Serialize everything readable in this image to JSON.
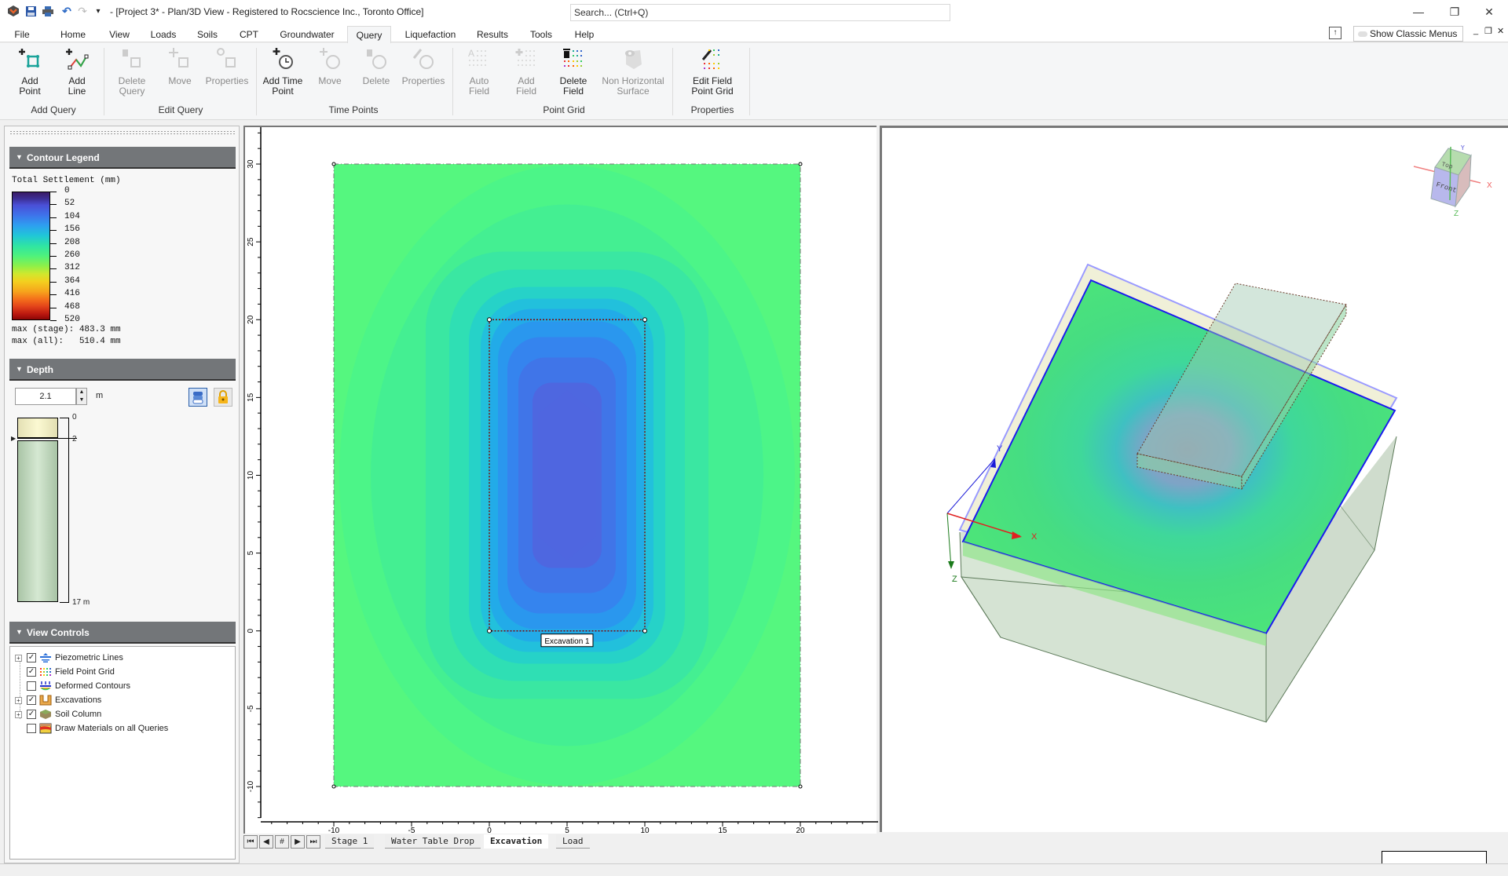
{
  "titlebar": {
    "title": "- [Project 3* - Plan/3D View - Registered to Rocscience Inc., Toronto Office]",
    "search_placeholder": "Search... (Ctrl+Q)",
    "minimize": "—",
    "restore": "❐",
    "close": "✕"
  },
  "menu_tabs": [
    {
      "label": "File"
    },
    {
      "label": "Home"
    },
    {
      "label": "View"
    },
    {
      "label": "Loads"
    },
    {
      "label": "Soils"
    },
    {
      "label": "CPT"
    },
    {
      "label": "Groundwater"
    },
    {
      "label": "Query"
    },
    {
      "label": "Liquefaction"
    },
    {
      "label": "Results"
    },
    {
      "label": "Tools"
    },
    {
      "label": "Help"
    }
  ],
  "active_tab": "Query",
  "show_classic_menus": "Show Classic Menus",
  "ribbon": {
    "add_query": {
      "group": "Add Query",
      "add_point": "Add\nPoint",
      "add_line": "Add\nLine"
    },
    "edit_query": {
      "group": "Edit Query",
      "delete_query": "Delete\nQuery",
      "move": "Move",
      "properties": "Properties"
    },
    "time_points": {
      "group": "Time Points",
      "add_time_point": "Add Time\nPoint",
      "move": "Move",
      "delete": "Delete",
      "properties": "Properties"
    },
    "point_grid": {
      "group": "Point Grid",
      "auto_field": "Auto\nField",
      "add_field": "Add\nField",
      "delete_field": "Delete\nField",
      "non_horizontal_surface": "Non Horizontal\nSurface"
    },
    "properties": {
      "group": "Properties",
      "edit_field_point_grid": "Edit Field\nPoint Grid"
    }
  },
  "contour_legend": {
    "header": "Contour Legend",
    "title": "Total Settlement (mm)",
    "ticks": [
      "0",
      "52",
      "104",
      "156",
      "208",
      "260",
      "312",
      "364",
      "416",
      "468",
      "520"
    ],
    "max_stage": "max (stage): 483.3 mm",
    "max_all": "max (all):   510.4 mm"
  },
  "depth": {
    "header": "Depth",
    "value": "2.1",
    "unit": "m",
    "column_labels": [
      "0",
      "2",
      "17 m"
    ],
    "layer_top": 0,
    "layer_boundary": 2,
    "column_bottom": 17
  },
  "view_controls": {
    "header": "View Controls",
    "items": [
      {
        "label": "Piezometric Lines",
        "checked": true,
        "expandable": true
      },
      {
        "label": "Field Point Grid",
        "checked": true,
        "expandable": false
      },
      {
        "label": "Deformed Contours",
        "checked": false,
        "expandable": false
      },
      {
        "label": "Excavations",
        "checked": true,
        "expandable": true
      },
      {
        "label": "Soil Column",
        "checked": true,
        "expandable": true
      },
      {
        "label": "Draw Materials on all Queries",
        "checked": false,
        "expandable": false
      }
    ]
  },
  "plan_view": {
    "x_ticks": [
      "-10",
      "-5",
      "0",
      "5",
      "10",
      "15",
      "20"
    ],
    "y_ticks": [
      "30",
      "25",
      "20",
      "15",
      "10",
      "5",
      "0",
      "-5",
      "-10"
    ],
    "excavation_label": "Excavation 1",
    "extent": {
      "xmin": -10,
      "xmax": 20,
      "ymin": -10,
      "ymax": 30
    },
    "excavation": {
      "xmin": 0,
      "xmax": 10,
      "ymin": 0,
      "ymax": 20
    }
  },
  "view3d": {
    "axis_x": "X",
    "axis_y": "Y",
    "axis_z": "Z",
    "cube_top": "Top",
    "cube_front": "Front"
  },
  "stage_tabs": [
    {
      "label": "Stage 1",
      "active": false
    },
    {
      "label": "Water Table Drop",
      "active": false
    },
    {
      "label": "Excavation",
      "active": true
    },
    {
      "label": "Load",
      "active": false
    }
  ],
  "stage_nav": {
    "first": "⏮",
    "prev": "◀",
    "hash": "#",
    "next": "▶",
    "last": "⏭"
  },
  "colors": {
    "green_field": "#55f77f",
    "contour_blue": "#4e67e0",
    "panel_header": "#737679"
  }
}
